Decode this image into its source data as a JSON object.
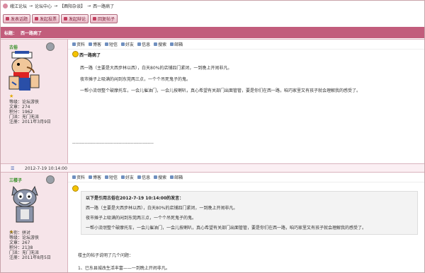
{
  "breadcrumb": {
    "parts": [
      "峨江论坛",
      "→",
      "论坛中心",
      "→",
      "【酉阳杂谈】",
      "→",
      "西一路病了"
    ]
  },
  "toolbar": {
    "buttons": [
      "发表话题",
      "发起投票",
      "发起辩论",
      "回复帖子"
    ]
  },
  "thread": {
    "label": "标题：",
    "title": "西一路病了"
  },
  "actions": {
    "items": [
      "资料",
      "博客",
      "短信",
      "好友",
      "信息",
      "搜索",
      "邮箱"
    ]
  },
  "post1": {
    "username": "古俗",
    "stats": [
      "等级：论坛游侠",
      "文章：274",
      "积分：1962",
      "门派：无门无派",
      "注册：2011年3月9日"
    ],
    "title": "西一路病了",
    "lines": [
      "西一路（主要是大西步林以西），白天80%的店铺四门紧闭，一到晚上开闹非凡。",
      "夜市摊子上吸满的闲到东莞两三点，一个个吊死鬼子的鬼。",
      "一帮小流氓整个破摩托车，一会儿催油门，一会儿按喇叭，真心希望有关部门出面管管，要是你们在西一路，咱巧家里又有孩子就会理解我的感受了。"
    ],
    "signature": "-----------------------------------------------------",
    "timestamp": "2012-7-19 10:14:00"
  },
  "post2": {
    "username": "三楼子",
    "stats": [
      "头衔：拼对",
      "等级：论坛游侠",
      "文章：267",
      "积分：2138",
      "门派：无门无派",
      "注册：2011年8月5日"
    ],
    "quote_header": "以下是引用古俗在2012-7-19 10:14:00的发言：",
    "quote_lines": [
      "西一路（主要是大西步林以西），白天80%的店铺四门紧闭，一到晚上开闹非凡。",
      "夜市摊子上吸满的闲到东莞两三点，一个个吊死鬼子的鬼。",
      "一帮小流氓整个破摩托车，一会儿催油门，一会儿按喇叭，真心希望有关部门出面管管，要是你们在西一路，咱巧家里又有孩子就会理解我的感受了。"
    ],
    "reply_lines": [
      "楼主的帖子说明了几个问题：",
      "1、已东县城改生活丰富——一到晚上开闹非凡。"
    ]
  }
}
